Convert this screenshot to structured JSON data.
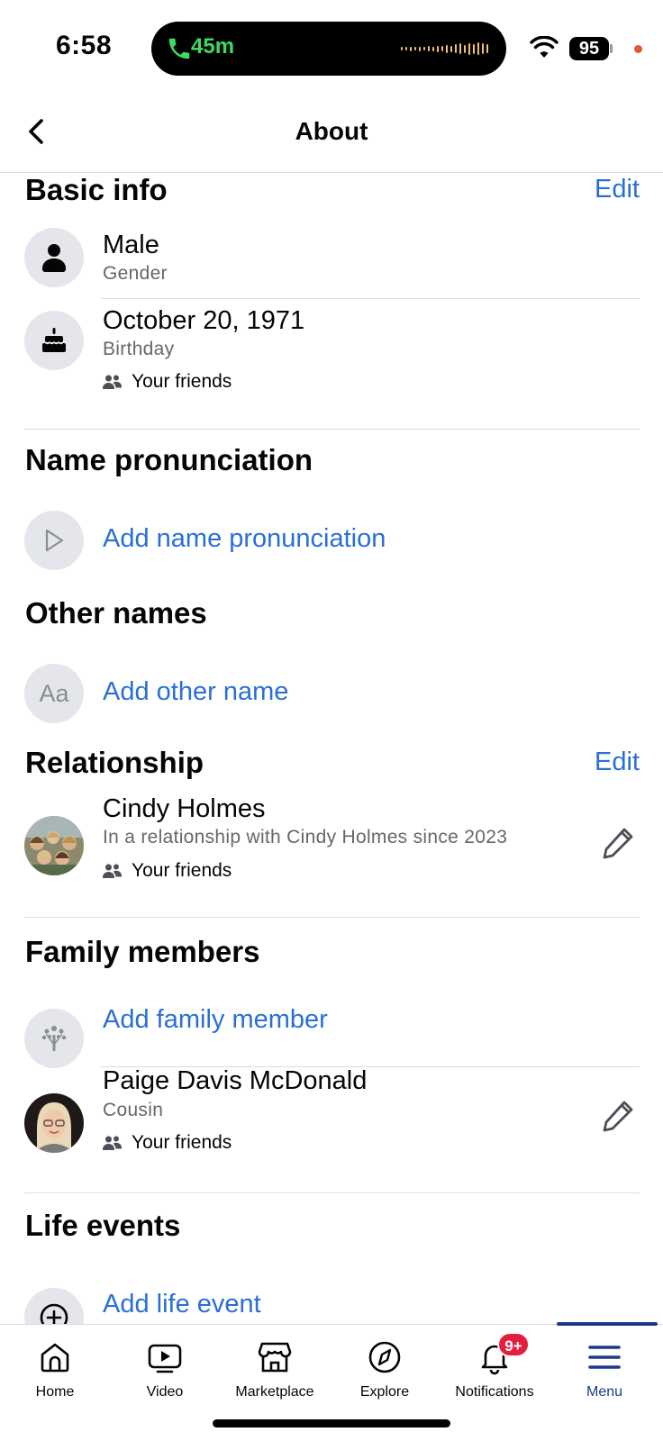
{
  "status_bar": {
    "time": "6:58",
    "call_duration": "45m",
    "battery": "95"
  },
  "header": {
    "title": "About"
  },
  "basic_info": {
    "title": "Basic info",
    "edit_label": "Edit",
    "gender": {
      "value": "Male",
      "label": "Gender"
    },
    "birthday": {
      "value": "October 20, 1971",
      "label": "Birthday",
      "audience": "Your friends"
    }
  },
  "name_pronunciation": {
    "title": "Name pronunciation",
    "action": "Add name pronunciation"
  },
  "other_names": {
    "title": "Other names",
    "icon_text": "Aa",
    "action": "Add other name"
  },
  "relationship": {
    "title": "Relationship",
    "edit_label": "Edit",
    "name": "Cindy Holmes",
    "detail": "In a relationship with Cindy Holmes since 2023",
    "audience": "Your friends"
  },
  "family_members": {
    "title": "Family members",
    "action": "Add family member",
    "member": {
      "name": "Paige Davis McDonald",
      "relation": "Cousin",
      "audience": "Your friends"
    }
  },
  "life_events": {
    "title": "Life events",
    "action": "Add life event"
  },
  "bottom_nav": {
    "items": [
      {
        "label": "Home",
        "icon": "home-icon"
      },
      {
        "label": "Video",
        "icon": "video-icon"
      },
      {
        "label": "Marketplace",
        "icon": "marketplace-icon"
      },
      {
        "label": "Explore",
        "icon": "explore-icon"
      },
      {
        "label": "Notifications",
        "icon": "bell-icon",
        "badge": "9+"
      },
      {
        "label": "Menu",
        "icon": "menu-icon",
        "active": true
      }
    ]
  },
  "colors": {
    "link": "#2a6fd6",
    "nav_active": "#1b3a8a",
    "badge": "#e41e3f"
  }
}
